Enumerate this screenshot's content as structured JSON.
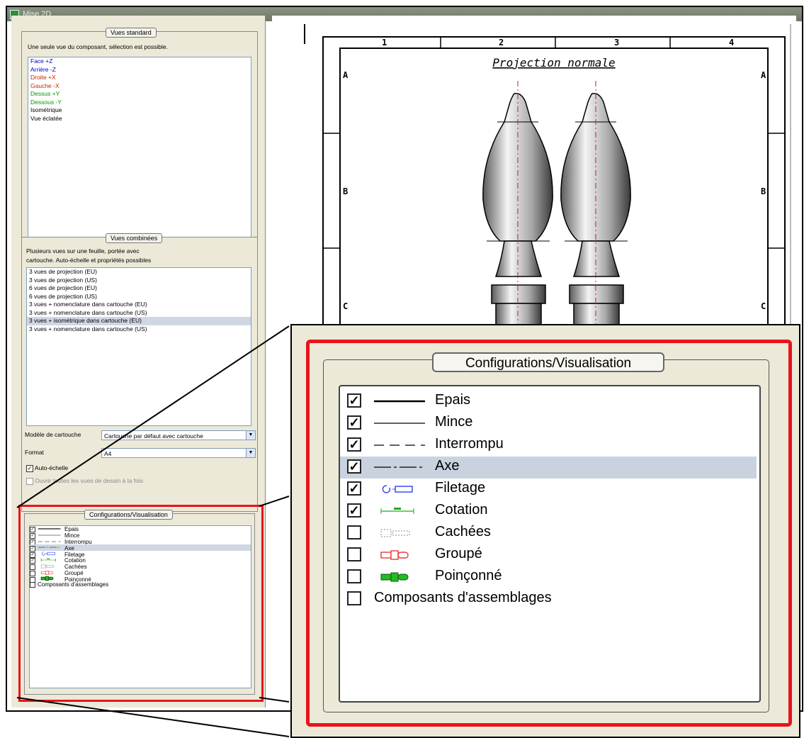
{
  "window": {
    "title": "Mise 2D"
  },
  "standard_views": {
    "label": "Vues standard",
    "description": "Une seule vue du composant, sélection est possible.",
    "items": [
      {
        "label": "Face +Z",
        "color": "#0000cc"
      },
      {
        "label": "Arrière -Z",
        "color": "#0000cc"
      },
      {
        "label": "Droite +X",
        "color": "#cc2200"
      },
      {
        "label": "Gauche -X",
        "color": "#cc2200"
      },
      {
        "label": "Dessus +Y",
        "color": "#009900"
      },
      {
        "label": "Dessous -Y",
        "color": "#009900"
      },
      {
        "label": "Isométrique",
        "color": "#000000"
      },
      {
        "label": "Vue éclatée",
        "color": "#000000"
      }
    ]
  },
  "combined_views": {
    "label": "Vues combinées",
    "description_1": "Plusieurs vues sur une feuille, portée avec",
    "description_2": "cartouche. Auto-échelle et propriétés possibles",
    "items": [
      {
        "label": "3 vues de projection (EU)",
        "selected": false
      },
      {
        "label": "3 vues de projection (US)",
        "selected": false
      },
      {
        "label": "6 vues de projection (EU)",
        "selected": false
      },
      {
        "label": "6 vues de projection (US)",
        "selected": false
      },
      {
        "label": "3 vues + nomenclature dans cartouche (EU)",
        "selected": false
      },
      {
        "label": "3 vues + nomenclature dans cartouche (US)",
        "selected": false
      },
      {
        "label": "3 vues + isométrique dans cartouche (EU)",
        "selected": true
      },
      {
        "label": "3 vues + nomenclature dans cartouche (US)",
        "selected": false
      }
    ],
    "cartouche_label": "Modèle de cartouche",
    "cartouche_value": "Cartouche par défaut avec cartouche",
    "format_label": "Format",
    "format_value": "A4",
    "auto_scale_label": "Auto-échelle",
    "auto_scale_checked": true,
    "opt_label": "Ouvrir toutes les vues de dessin à la fois",
    "opt_checked": false
  },
  "config": {
    "label": "Configurations/Visualisation",
    "small_labels": [
      "Epais",
      "Mince",
      "Interrompu",
      "Axe",
      "Filetage",
      "Cotation",
      "Cachées",
      "Groupé",
      "Poinçonné"
    ],
    "items": [
      {
        "label": "Epais",
        "checked": true,
        "symbol": "thick-line-icon",
        "selected": false
      },
      {
        "label": "Mince",
        "checked": true,
        "symbol": "thin-line-icon",
        "selected": false
      },
      {
        "label": "Interrompu",
        "checked": true,
        "symbol": "dashed-line-icon",
        "selected": false
      },
      {
        "label": "Axe",
        "checked": true,
        "symbol": "axis-line-icon",
        "selected": true
      },
      {
        "label": "Filetage",
        "checked": true,
        "symbol": "thread-icon",
        "selected": false
      },
      {
        "label": "Cotation",
        "checked": true,
        "symbol": "dimension-icon",
        "selected": false
      },
      {
        "label": "Cachées",
        "checked": false,
        "symbol": "hidden-icon",
        "selected": false
      },
      {
        "label": "Groupé",
        "checked": false,
        "symbol": "grouped-icon",
        "selected": false
      },
      {
        "label": "Poinçonné",
        "checked": false,
        "symbol": "punched-icon",
        "selected": false
      },
      {
        "label": "Composants d'assemblages",
        "checked": false,
        "symbol": "",
        "selected": false
      }
    ]
  },
  "drawing": {
    "title": "Projection normale",
    "col_labels": [
      "1",
      "2",
      "3",
      "4"
    ],
    "row_labels": [
      "A",
      "B",
      "C"
    ]
  },
  "colors": {
    "highlight": "#e8141c",
    "selected_row": "#c9d3df",
    "panel_bg": "#ece9d8"
  }
}
